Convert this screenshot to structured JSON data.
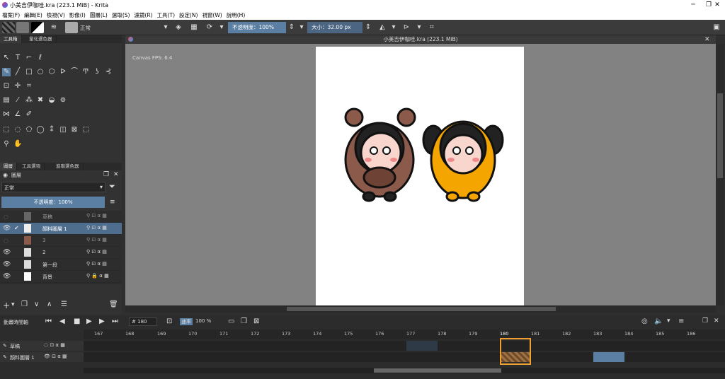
{
  "window": {
    "title": "小美吉伊咖哇.kra (223.1 MiB)  - Krita",
    "minimize": "─",
    "maximize": "❐",
    "close": "✕"
  },
  "menu": [
    "檔案(F)",
    "編輯(E)",
    "檢視(V)",
    "影像(I)",
    "圖層(L)",
    "選取(S)",
    "濾鏡(R)",
    "工具(T)",
    "設定(N)",
    "視窗(W)",
    "說明(H)"
  ],
  "toolbar": {
    "blend_mode": "正常",
    "opacity_label": "不透明度：100%",
    "size_label": "大小：32.00 px"
  },
  "docker_tabs": [
    "工具箱",
    "量化選色器"
  ],
  "canvas": {
    "title": "小美吉伊咖哇.kra (223.1 MiB)",
    "fps": "Canvas FPS: 6.4"
  },
  "layers_panel": {
    "tabs": [
      "圖層",
      "工具選項",
      "進階選色器"
    ],
    "title": "圖層",
    "blend_mode": "正常",
    "opacity": "不透明度：100%",
    "layers": [
      {
        "name": "草稿",
        "selected": false
      },
      {
        "name": "顏料圖層 1",
        "selected": true
      },
      {
        "name": "3",
        "selected": false
      },
      {
        "name": "2",
        "selected": false
      },
      {
        "name": "第一段",
        "selected": false
      },
      {
        "name": "背景",
        "selected": false
      }
    ]
  },
  "timeline": {
    "title": "動畫時間軸",
    "frame": "180",
    "speed_label": "速率",
    "speed": "100 %",
    "frames": [
      "167",
      "168",
      "169",
      "170",
      "171",
      "172",
      "173",
      "174",
      "175",
      "176",
      "177",
      "178",
      "179",
      "180",
      "181",
      "182",
      "183",
      "184",
      "185",
      "186"
    ],
    "tracks": [
      "草稿",
      "顏料圖層 1"
    ]
  }
}
